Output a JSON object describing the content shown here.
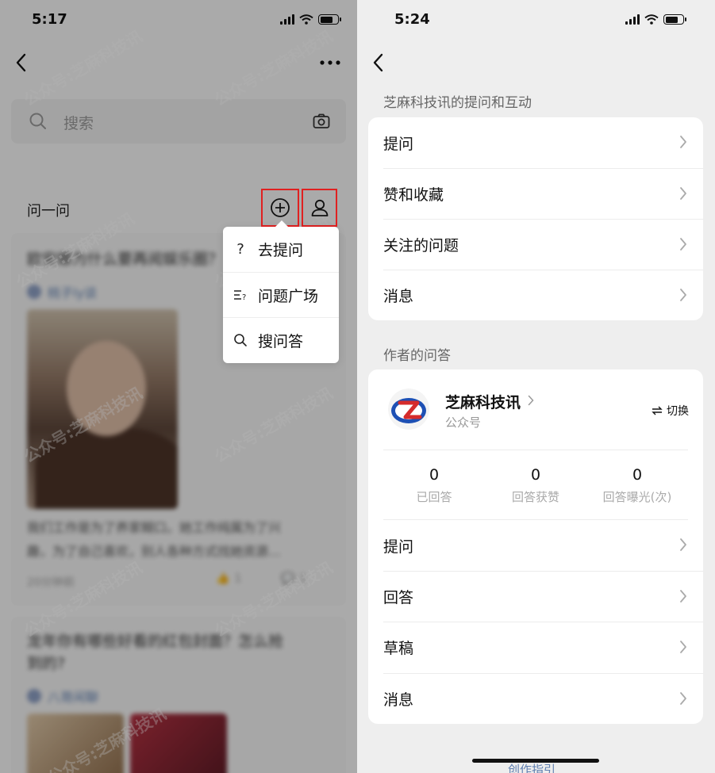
{
  "left": {
    "status_time": "5:17",
    "search_placeholder": "搜索",
    "section_title": "问一问",
    "popover": {
      "items": [
        {
          "icon": "question-icon",
          "label": "去提问"
        },
        {
          "icon": "list-question-icon",
          "label": "问题广场"
        },
        {
          "icon": "search-icon",
          "label": "搜问答"
        }
      ]
    },
    "feed": [
      {
        "title": "欧安娜为什么要再阅娱乐圈？",
        "author": "桃子ly谈",
        "text_1": "我们工作是为了养家糊口。她工作纯属为了兴",
        "text_2": "趣，为了自己喜欢，别人各种方式找她资源…",
        "time": "20分钟前",
        "likes": "1",
        "comments": "1"
      },
      {
        "title_1": "龙年你有哪些好看的红包封面？怎么抢",
        "title_2": "到的?",
        "author": "八哥闲聊"
      }
    ],
    "watermark": "公众号:芝麻科技讯"
  },
  "right": {
    "status_time": "5:24",
    "section_interactions": "芝麻科技讯的提问和互动",
    "interactions": [
      "提问",
      "赞和收藏",
      "关注的问题",
      "消息"
    ],
    "section_author": "作者的问答",
    "author": {
      "name": "芝麻科技讯",
      "type": "公众号",
      "switch_label": "切换"
    },
    "stats": [
      {
        "value": "0",
        "label": "已回答"
      },
      {
        "value": "0",
        "label": "回答获赞"
      },
      {
        "value": "0",
        "label": "回答曝光(次)"
      }
    ],
    "author_menu": [
      "提问",
      "回答",
      "草稿",
      "消息"
    ],
    "bottom_link": "创作指引"
  },
  "colors": {
    "highlight_box": "#e02020",
    "link_blue": "#5f7fb0",
    "logo_blue": "#1e50b4",
    "logo_red": "#d52b2b"
  }
}
